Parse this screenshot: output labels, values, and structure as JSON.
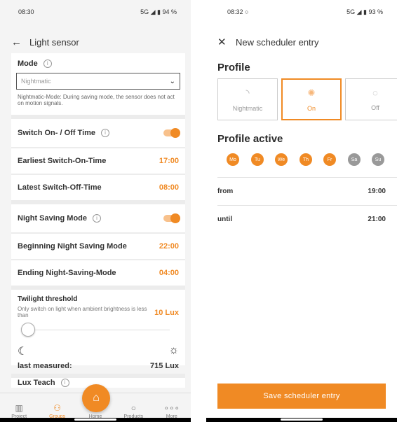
{
  "left": {
    "status": {
      "time": "08:30",
      "right": "5G ◢ ▮ 94 %"
    },
    "title": "Light sensor",
    "mode": {
      "label": "Mode",
      "selected": "Nightmatic",
      "description": "Nightmatic-Mode: During saving mode, the sensor does not act on motion signals."
    },
    "switch_time": {
      "label": "Switch On- / Off Time",
      "enabled": true
    },
    "earliest": {
      "label": "Earliest Switch-On-Time",
      "value": "17:00"
    },
    "latest": {
      "label": "Latest Switch-Off-Time",
      "value": "08:00"
    },
    "night_saving": {
      "label": "Night Saving Mode",
      "enabled": true
    },
    "beginning": {
      "label": "Beginning Night Saving Mode",
      "value": "22:00"
    },
    "ending": {
      "label": "Ending Night-Saving-Mode",
      "value": "04:00"
    },
    "twilight": {
      "label": "Twilight threshold",
      "description": "Only switch on light when ambient brightness is less than",
      "value": "10 Lux",
      "slider_level": 0.0
    },
    "last_measured": {
      "label": "last measured:",
      "value": "715 Lux"
    },
    "lux_teach": {
      "label": "Lux Teach"
    },
    "nav": [
      {
        "label": "Project",
        "icon": "building-icon"
      },
      {
        "label": "Groups",
        "icon": "groups-icon"
      },
      {
        "label": "Home",
        "icon": "home-icon"
      },
      {
        "label": "Products",
        "icon": "products-icon"
      },
      {
        "label": "More",
        "icon": "more-icon"
      }
    ]
  },
  "right": {
    "status": {
      "time": "08:32",
      "right": "5G ◢ ▮ 93 %"
    },
    "title": "New scheduler entry",
    "profile_heading": "Profile",
    "profiles": [
      {
        "label": "Nightmatic",
        "icon": "nightmatic-icon",
        "selected": false
      },
      {
        "label": "On",
        "icon": "light-on-icon",
        "selected": true
      },
      {
        "label": "Off",
        "icon": "light-off-icon",
        "selected": false
      }
    ],
    "active_heading": "Profile active",
    "days": [
      {
        "label": "Mo",
        "active": true
      },
      {
        "label": "Tu",
        "active": true
      },
      {
        "label": "We",
        "active": true
      },
      {
        "label": "Th",
        "active": true
      },
      {
        "label": "Fr",
        "active": true
      },
      {
        "label": "Sa",
        "active": false
      },
      {
        "label": "Su",
        "active": false
      }
    ],
    "from": {
      "label": "from",
      "value": "19:00"
    },
    "until": {
      "label": "until",
      "value": "21:00"
    },
    "save": "Save scheduler entry"
  },
  "colors": {
    "accent": "#f08a24",
    "inactive": "#999999"
  }
}
